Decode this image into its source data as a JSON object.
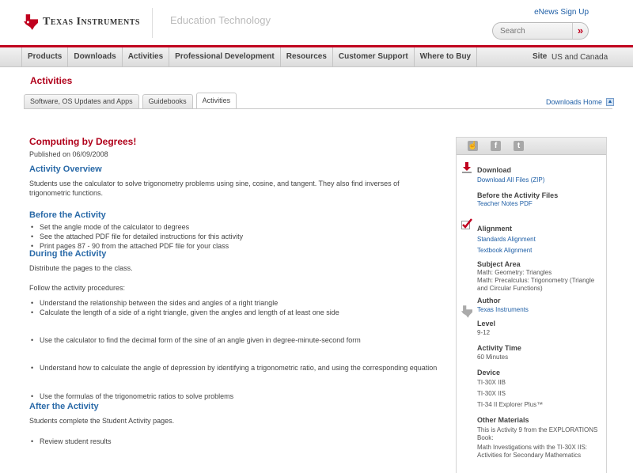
{
  "header": {
    "brand": "Texas Instruments",
    "section_title": "Education Technology",
    "enews_link": "eNews Sign Up",
    "search_placeholder": "Search",
    "search_button": "»"
  },
  "nav": {
    "items": [
      "Products",
      "Downloads",
      "Activities",
      "Professional Development",
      "Resources",
      "Customer Support",
      "Where to Buy"
    ],
    "site_label": "Site",
    "site_value": "US and Canada"
  },
  "page_heading": "Activities",
  "tabs": [
    {
      "label": "Software, OS Updates and Apps",
      "active": false
    },
    {
      "label": "Guidebooks",
      "active": false
    },
    {
      "label": "Activities",
      "active": true
    }
  ],
  "downloads_home": "Downloads Home",
  "activity": {
    "title": "Computing by Degrees!",
    "published": "Published on 06/09/2008",
    "overview_heading": "Activity Overview",
    "overview_text": "Students use the calculator to solve trigonometry problems using sine, cosine, and tangent. They also find inverses of trigonometric functions.",
    "before_heading": "Before the Activity",
    "before_items": [
      "Set the angle mode of the calculator to degrees",
      "See the attached PDF file for detailed instructions for this activity",
      "Print pages 87 - 90 from the attached PDF file for your class"
    ],
    "during_heading": "During the Activity",
    "during_text1": "Distribute the pages to the class.",
    "during_text2": "Follow the activity procedures:",
    "during_items": [
      "Understand the relationship between the sides and angles of a right triangle",
      "Calculate the length of a side of a right triangle, given the angles and length of at least one side",
      "Use the calculator to find the decimal form of the sine of an angle given in degree-minute-second form",
      "Understand how to calculate the angle of depression by identifying a trigonometric ratio, and using the corresponding equation",
      "Use the formulas of the trigonometric ratios to solve problems"
    ],
    "after_heading": "After the Activity",
    "after_text": "Students complete the Student Activity pages.",
    "after_items": [
      "Review student results"
    ]
  },
  "sidebar": {
    "share_icons": [
      "thumbs-up-icon",
      "facebook-icon",
      "twitter-icon"
    ],
    "download_heading": "Download",
    "download_link": "Download All Files (ZIP)",
    "before_files_heading": "Before the Activity Files",
    "teacher_notes_link": "Teacher Notes PDF",
    "alignment_heading": "Alignment",
    "standards_link": "Standards Alignment",
    "textbook_link": "Textbook Alignment",
    "subject_heading": "Subject Area",
    "subject_line1": "Math: Geometry: Triangles",
    "subject_line2": "Math: Precalculus: Trigonometry (Triangle and Circular Functions)",
    "author_heading": "Author",
    "author_link": "Texas Instruments",
    "level_heading": "Level",
    "level_value": "9-12",
    "time_heading": "Activity Time",
    "time_value": "60 Minutes",
    "device_heading": "Device",
    "devices": [
      "TI-30X IIB",
      "TI-30X IIS",
      "TI-34 II Explorer Plus™"
    ],
    "other_heading": "Other Materials",
    "other_text1": "This is Activity 9 from the EXPLORATIONS Book:",
    "other_text2": "Math Investigations with the TI-30X IIS: Activities for Secondary Mathematics"
  },
  "colors": {
    "brand_red": "#c0001e",
    "link_blue": "#1f5fa6",
    "heading_blue": "#2a6aa8"
  }
}
